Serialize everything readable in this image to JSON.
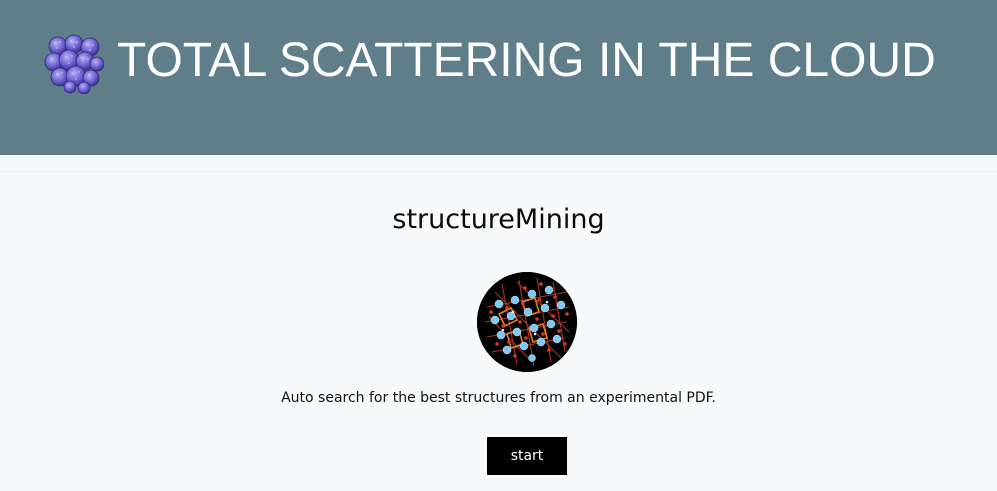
{
  "header": {
    "title": "TOTAL SCATTERING IN THE CLOUD",
    "logo_icon": "molecule-cluster-icon",
    "background_color": "#5f7e89"
  },
  "app": {
    "title": "structureMining",
    "image_icon": "crystal-structure-icon",
    "description": "Auto search for the best structures from an experimental PDF.",
    "start_label": "start"
  }
}
